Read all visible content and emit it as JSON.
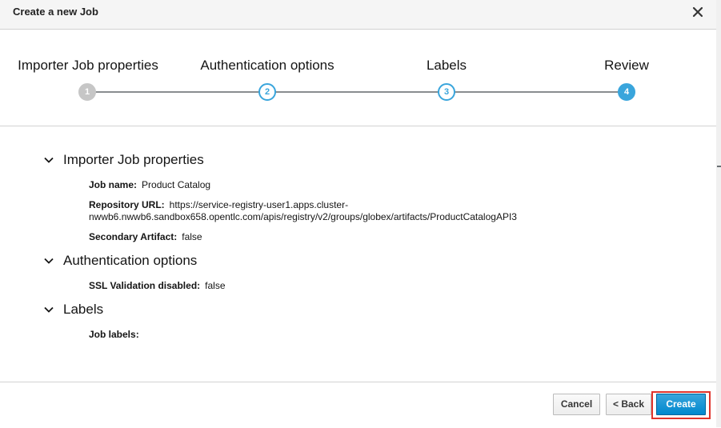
{
  "modal": {
    "title": "Create a new Job"
  },
  "wizard": {
    "steps": [
      {
        "label": "Importer Job properties",
        "number": "1",
        "state": "completed"
      },
      {
        "label": "Authentication options",
        "number": "2",
        "state": "upcoming"
      },
      {
        "label": "Labels",
        "number": "3",
        "state": "upcoming"
      },
      {
        "label": "Review",
        "number": "4",
        "state": "active"
      }
    ]
  },
  "review": {
    "importer": {
      "heading": "Importer Job properties",
      "job_name_label": "Job name:",
      "job_name_value": "Product Catalog",
      "repo_url_label": "Repository URL:",
      "repo_url_line1": "https://service-registry-user1.apps.cluster-",
      "repo_url_line2": "nwwb6.nwwb6.sandbox658.opentlc.com/apis/registry/v2/groups/globex/artifacts/ProductCatalogAPI3",
      "secondary_label": "Secondary Artifact:",
      "secondary_value": "false"
    },
    "auth": {
      "heading": "Authentication options",
      "ssl_label": "SSL Validation disabled:",
      "ssl_value": "false"
    },
    "labels": {
      "heading": "Labels",
      "job_labels_label": "Job labels:"
    }
  },
  "footer": {
    "cancel_label": "Cancel",
    "back_label": "< Back",
    "create_label": "Create"
  },
  "colors": {
    "accent": "#39a5dc",
    "primary": "#0088ce",
    "highlight": "#e0342c"
  },
  "icons": {
    "close": "close-icon",
    "chevron": "chevron-down-icon"
  }
}
